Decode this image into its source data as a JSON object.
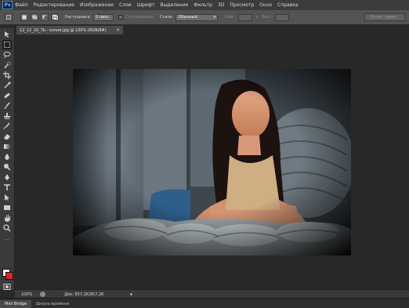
{
  "app": {
    "logo": "Ps"
  },
  "menu": [
    "Файл",
    "Редактирование",
    "Изображение",
    "Слои",
    "Шрифт",
    "Выделение",
    "Фильтр",
    "3D",
    "Просмотр",
    "Окно",
    "Справка"
  ],
  "options": {
    "feather_label": "Растушевка:",
    "feather_value": "0 пикс.",
    "antialias_label": "Сглаживание",
    "style_label": "Стиль:",
    "style_value": "Обычный",
    "width_label": "Шир.:",
    "height_label": "Выс.:",
    "refine_button": "Уточн. край..."
  },
  "document": {
    "tab_title": "12_12_10_7b - копия.jpg @ 100% (RGB/8#)",
    "close": "×"
  },
  "status": {
    "zoom": "100%",
    "doc_size": "Док: 857,2K/857,2K",
    "arrow": "▸"
  },
  "panels": [
    "Mini Bridge",
    "Шкала времени"
  ],
  "colors": {
    "foreground": "#ffffff",
    "background": "#d9262b",
    "accent": "#4e8fd6"
  },
  "tools": [
    "move-icon",
    "marquee-icon",
    "lasso-icon",
    "quick-select-icon",
    "crop-icon",
    "eyedropper-icon",
    "healing-icon",
    "brush-icon",
    "stamp-icon",
    "history-brush-icon",
    "eraser-icon",
    "gradient-icon",
    "blur-icon",
    "dodge-icon",
    "pen-icon",
    "type-icon",
    "path-select-icon",
    "shape-icon",
    "hand-icon",
    "zoom-icon"
  ]
}
